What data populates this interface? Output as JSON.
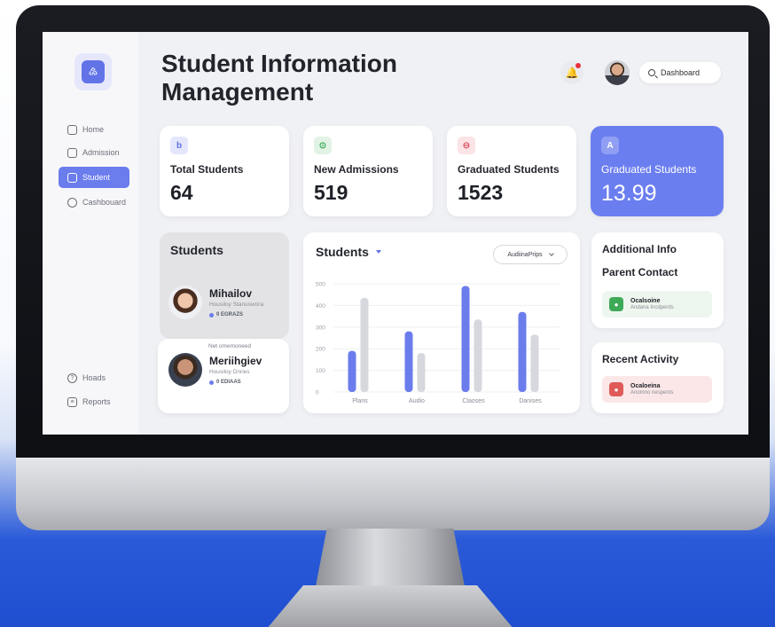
{
  "page": {
    "title": "Student Information Management",
    "search_label": "Dashboard"
  },
  "sidebar": {
    "items": [
      {
        "label": "Home",
        "icon": "home-icon"
      },
      {
        "label": "Admission",
        "icon": "folder-icon"
      },
      {
        "label": "Student",
        "icon": "student-card-icon",
        "active": true
      },
      {
        "label": "Cashbouard",
        "icon": "paperclip-icon"
      }
    ],
    "bottom_items": [
      {
        "label": "Hoads",
        "icon": "help-icon"
      },
      {
        "label": "Reports",
        "icon": "reports-icon"
      }
    ]
  },
  "stats": [
    {
      "icon_letter": "b",
      "label": "Total Students",
      "value": "64",
      "accent": "#6273e8"
    },
    {
      "icon_letter": "⊙",
      "label": "New Admissions",
      "value": "519",
      "accent": "#3eaa58"
    },
    {
      "icon_letter": "⊖",
      "label": "Graduated Students",
      "value": "1523",
      "accent": "#e05a6a"
    },
    {
      "icon_letter": "A",
      "label": "Graduated Students",
      "value": "13.99",
      "accent": "#6b7ef0"
    }
  ],
  "students": {
    "title": "Students",
    "list": [
      {
        "name": "Mihailov",
        "subtitle": "Housiloy Stanuswora",
        "badge": "0 EGRAZS"
      },
      {
        "name": "Meriihgiev",
        "subtitle": "Housiloy Dnries",
        "badge": "0 EDIAAS",
        "header": "Net omemoneed"
      }
    ]
  },
  "chart_panel": {
    "title": "Students",
    "select_label": "AudiinaPrips"
  },
  "chart_data": {
    "type": "bar",
    "categories": [
      "Plans",
      "Audio",
      "Claoses",
      "Danises"
    ],
    "series": [
      {
        "values": [
          190,
          280,
          490,
          370
        ],
        "color": "#6b7cec"
      },
      {
        "values": [
          435,
          180,
          335,
          265
        ],
        "color": "#d7d8dd"
      }
    ],
    "ylim": [
      0,
      500
    ],
    "yticks": [
      0,
      100,
      200,
      300,
      400,
      500
    ],
    "grid": true
  },
  "additional_info": {
    "title": "Additional Info",
    "subtitle": "Parent Contact",
    "contact_name": "Ocalsoine",
    "contact_sub": "Andana Incdperds"
  },
  "recent_activity": {
    "title": "Recent Activity",
    "name": "Ocaloeina",
    "sub": "Anomno nespents"
  },
  "colors": {
    "accent": "#6b7cec",
    "sidebar_active": "#6b7cec",
    "notification_dot": "#e8313a"
  }
}
